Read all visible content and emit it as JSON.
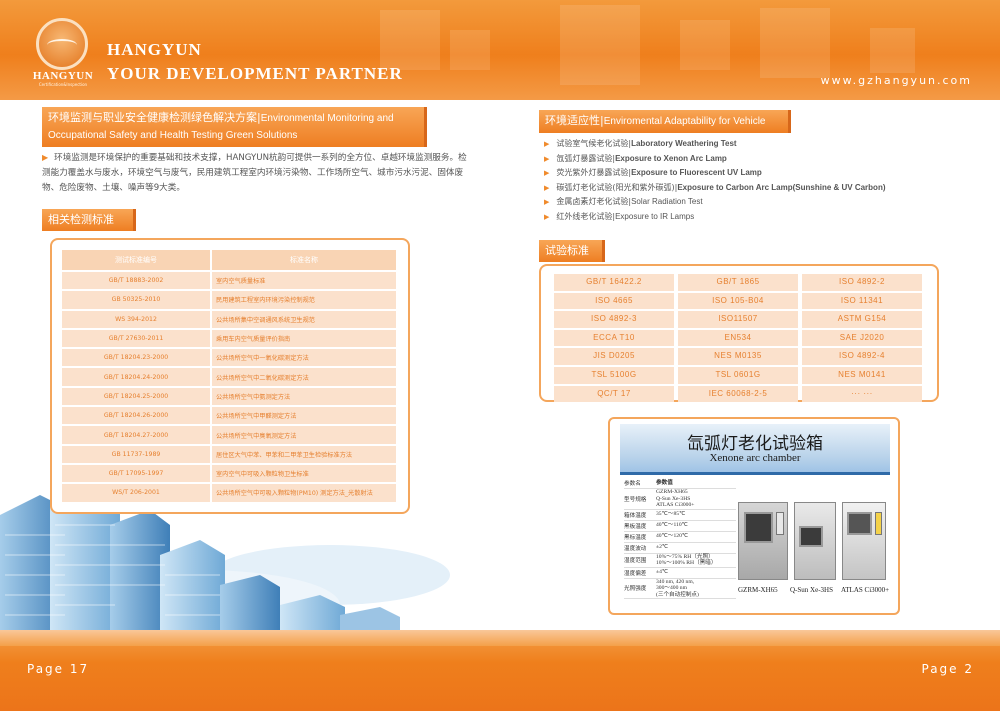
{
  "header": {
    "logo_text": "HANGYUN",
    "logo_subtext": "Certification&Inspection",
    "brand_line1": "HANGYUN",
    "brand_line2": "YOUR DEVELOPMENT PARTNER",
    "url": "www.gzhangyun.com"
  },
  "left": {
    "heading_cn": "环境监测与职业安全健康检测绿色解决方案|",
    "heading_en": "Environmental Monitoring and Occupational Safety and Health Testing Green Solutions",
    "paragraph": "环境监测是环境保护的重要基础和技术支撑，HANGYUN杭韵可提供一系列的全方位、卓越环境监测服务。检测能力覆盖水与废水，环境空气与废气，民用建筑工程室内环境污染物、工作场所空气、城市污水污泥、固体废物、危险废物、土壤、噪声等9大类。",
    "standards_heading": "相关检测标准",
    "table_header": [
      "测试标准编号",
      "标准名称"
    ],
    "table_rows": [
      [
        "GB/T 18883-2002",
        "室内空气质量标准"
      ],
      [
        "GB 50325-2010",
        "民用建筑工程室内环境污染控制规范"
      ],
      [
        "WS 394-2012",
        "公共场所集中空调通风系统卫生规范"
      ],
      [
        "GB/T 27630-2011",
        "乘用车内空气质量评价指南"
      ],
      [
        "GB/T 18204.23-2000",
        "公共场所空气中一氧化碳测定方法"
      ],
      [
        "GB/T 18204.24-2000",
        "公共场所空气中二氧化碳测定方法"
      ],
      [
        "GB/T 18204.25-2000",
        "公共场所空气中氨测定方法"
      ],
      [
        "GB/T 18204.26-2000",
        "公共场所空气中甲醛测定方法"
      ],
      [
        "GB/T 18204.27-2000",
        "公共场所空气中臭氧测定方法"
      ],
      [
        "GB 11737-1989",
        "居住区大气中苯、甲苯和二甲苯卫生检验标准方法"
      ],
      [
        "GB/T 17095-1997",
        "室内空气中可吸入颗粒物卫生标准"
      ],
      [
        "WS/T 206-2001",
        "公共场所空气中可吸入颗粒物(PM10) 测定方法_光散射法"
      ]
    ]
  },
  "right": {
    "heading_cn": "环境适应性|",
    "heading_en": "Enviromental Adaptability for Vehicle",
    "list": [
      {
        "cn": "试验室气候老化试验|",
        "en": "Laboratory Weathering Test",
        "bold": true
      },
      {
        "cn": "氙弧灯暴露试验|",
        "en": "Exposure to Xenon Arc Lamp",
        "bold": true
      },
      {
        "cn": "荧光紫外灯暴露试验|",
        "en": "Exposure to Fluorescent UV Lamp",
        "bold": true
      },
      {
        "cn": "碳弧灯老化试验(阳光和紫外碳弧)|",
        "en": "Exposure to Carbon Arc Lamp(Sunshine & UV Carbon)",
        "bold": true
      },
      {
        "cn": "金属卤素灯老化试验|",
        "en": "Solar Radiation Test",
        "bold": false
      },
      {
        "cn": "红外线老化试验|",
        "en": "Exposure to IR Lamps",
        "bold": false
      }
    ],
    "standards_heading": "试验标准",
    "standards": [
      "GB/T 16422.2",
      "GB/T 1865",
      "ISO 4892-2",
      "ISO 4665",
      "ISO 105-B04",
      "ISO 11341",
      "ISO 4892-3",
      "ISO11507",
      "ASTM G154",
      "ECCA T10",
      "EN534",
      "SAE J2020",
      "JIS D0205",
      "NES M0135",
      "ISO 4892-4",
      "TSL 5100G",
      "TSL 0601G",
      "NES M0141",
      "QC/T 17",
      "IEC 60068-2-5",
      "··· ···"
    ],
    "card": {
      "title_cn": "氙弧灯老化试验箱",
      "title_en": "Xenone arc chamber",
      "specs": [
        [
          "参数名",
          "参数值"
        ],
        [
          "型号规格",
          "GZRM-XH65\nQ-Sun Xe-3HS\nATLAS Ci3000+"
        ],
        [
          "箱体温度",
          "35℃～85℃"
        ],
        [
          "黑板温度",
          "40℃～110℃"
        ],
        [
          "黑标温度",
          "40℃～120℃"
        ],
        [
          "温度波动",
          "±2℃"
        ],
        [
          "湿度范围",
          "10%～75% RH（光照）\n10%～100% RH（黑暗）"
        ],
        [
          "湿度偏差",
          "±4℃"
        ],
        [
          "光照强度",
          "340 nm, 420 nm,\n300～400 nm\n(三个自动控制点)"
        ]
      ],
      "machines": [
        "GZRM-XH65",
        "Q-Sun Xe-3HS",
        "ATLAS Ci3000+"
      ]
    }
  },
  "footer": {
    "page_left": "Page 17",
    "page_right": "Page 2"
  }
}
